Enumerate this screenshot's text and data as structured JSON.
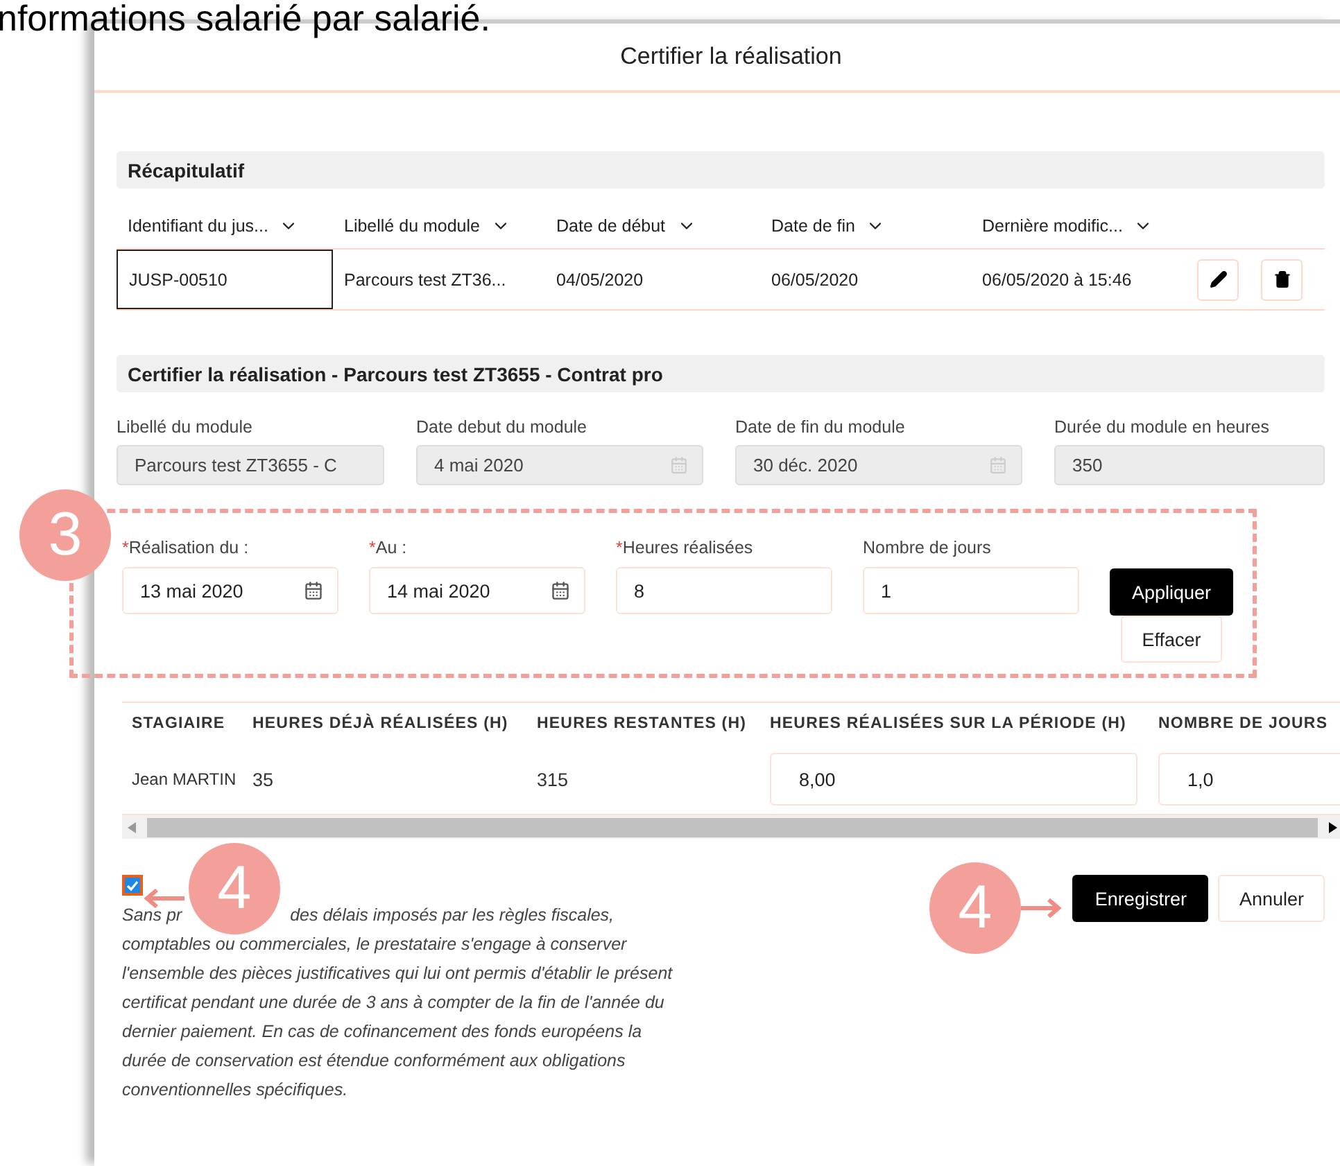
{
  "caption": "nformations salarié par salarié.",
  "dialog": {
    "title": "Certifier la réalisation"
  },
  "summary": {
    "heading": "Récapitulatif",
    "columns": [
      "Identifiant du jus...",
      "Libellé du module",
      "Date de début",
      "Date de fin",
      "Dernière modific..."
    ],
    "rows": [
      {
        "cells": [
          {
            "text": "JUSP-00510",
            "focused": true
          },
          {
            "text": "Parcours test ZT36...",
            "focused": false
          },
          {
            "text": "04/05/2020",
            "focused": false
          },
          {
            "text": "06/05/2020",
            "focused": false
          },
          {
            "text": "06/05/2020 à 15:46",
            "focused": false
          }
        ]
      }
    ]
  },
  "certify": {
    "heading": "Certifier la réalisation - Parcours test ZT3655 - Contrat pro",
    "module_fields": [
      {
        "label": "Libellé du module",
        "value": "Parcours test ZT3655 - C",
        "kind": "text"
      },
      {
        "label": "Date debut du module",
        "value": "4 mai 2020",
        "kind": "date"
      },
      {
        "label": "Date de fin du module",
        "value": "30 déc. 2020",
        "kind": "date"
      },
      {
        "label": "Durée du module en heures",
        "value": "350",
        "kind": "text"
      }
    ],
    "period_fields": [
      {
        "label": "Réalisation du :",
        "value": "13 mai 2020",
        "required": true,
        "kind": "date"
      },
      {
        "label": "Au :",
        "value": "14 mai 2020",
        "required": true,
        "kind": "date"
      },
      {
        "label": "Heures réalisées",
        "value": "8",
        "required": true,
        "kind": "text"
      },
      {
        "label": "Nombre de jours",
        "value": "1",
        "required": false,
        "kind": "text"
      }
    ],
    "required_mark": "*",
    "apply_button": "Appliquer",
    "clear_button": "Effacer"
  },
  "trainees": {
    "columns": [
      "STAGIAIRE",
      "HEURES DÉJÀ RÉALISÉES (H)",
      "HEURES RESTANTES (H)",
      "HEURES RÉALISÉES SUR LA PÉRIODE (H)",
      "NOMBRE DE JOURS"
    ],
    "rows": [
      {
        "cells": [
          {
            "text": "Jean MARTIN",
            "kind": "name"
          },
          {
            "text": "35",
            "kind": "text"
          },
          {
            "text": "315",
            "kind": "text"
          },
          {
            "text": "8,00",
            "kind": "input"
          },
          {
            "text": "1,0",
            "kind": "input"
          }
        ]
      }
    ]
  },
  "consent": {
    "checked": true,
    "visible_start": "Sans pr",
    "text": "des délais imposés par les règles fiscales, comptables ou commerciales, le prestataire s'engage à conserver l'ensemble des pièces justificatives qui lui ont permis d'établir le présent certificat pendant une durée de 3 ans à compter de la fin de l'année du dernier paiement. En cas de cofinancement des fonds européens la durée de conservation est étendue conformément aux obligations conventionnelles spécifiques."
  },
  "buttons": {
    "save": "Enregistrer",
    "cancel": "Annuler"
  },
  "annotations": [
    {
      "number": "3"
    },
    {
      "number": "4"
    },
    {
      "number": "4"
    }
  ]
}
